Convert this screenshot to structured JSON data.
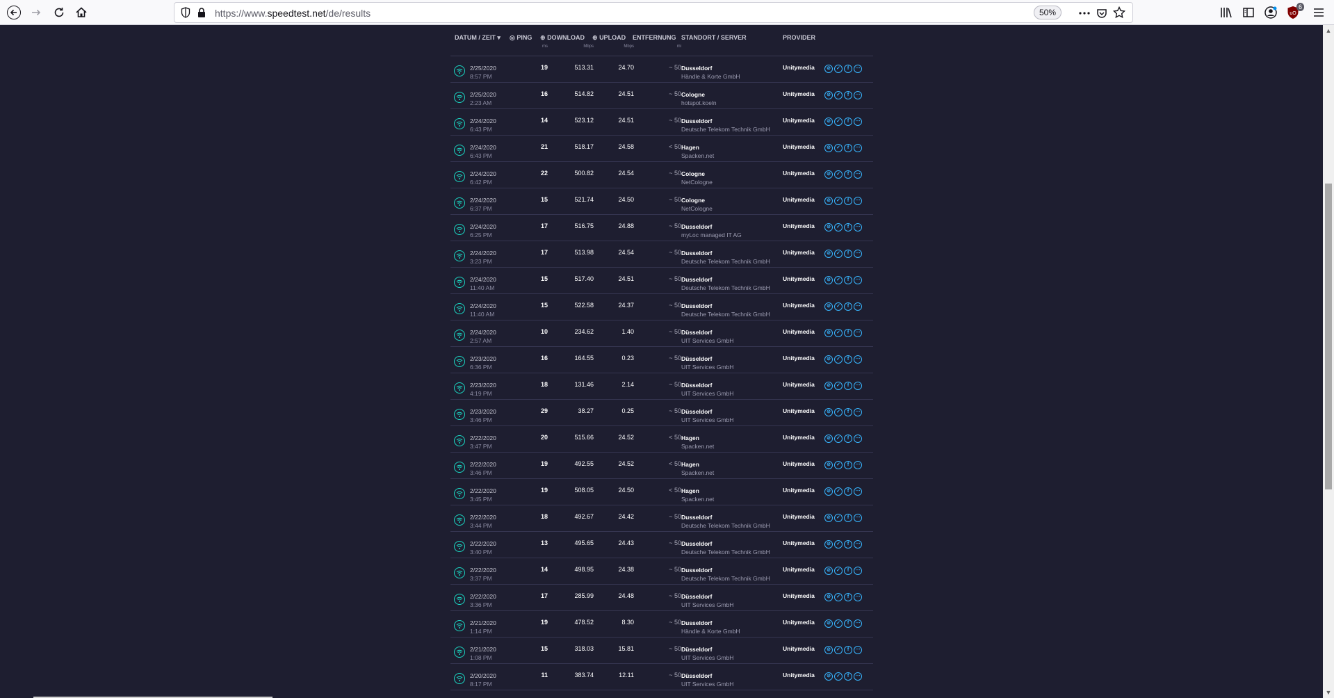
{
  "browser": {
    "url_prefix": "https://www.",
    "url_host": "speedtest.net",
    "url_path": "/de/results",
    "zoom": "50%",
    "addon_badge": "6"
  },
  "header": {
    "date": "DATUM / ZEIT",
    "ping": "PING",
    "ping_unit": "ms",
    "download": "DOWNLOAD",
    "download_unit": "Mbps",
    "upload": "UPLOAD",
    "upload_unit": "Mbps",
    "distance": "ENTFERNUNG",
    "distance_unit": "mi",
    "server": "STANDORT / SERVER",
    "provider": "PROVIDER"
  },
  "results": [
    {
      "date": "2/25/2020",
      "time": "8:57 PM",
      "ping": "19",
      "dl": "513.31",
      "ul": "24.70",
      "dist": "~ 50",
      "city": "Dusseldorf",
      "sponsor": "Händle & Korte GmbH",
      "provider": "Unitymedia"
    },
    {
      "date": "2/25/2020",
      "time": "2:23 AM",
      "ping": "16",
      "dl": "514.82",
      "ul": "24.51",
      "dist": "~ 50",
      "city": "Cologne",
      "sponsor": "hotspot.koeln",
      "provider": "Unitymedia"
    },
    {
      "date": "2/24/2020",
      "time": "6:43 PM",
      "ping": "14",
      "dl": "523.12",
      "ul": "24.51",
      "dist": "~ 50",
      "city": "Dusseldorf",
      "sponsor": "Deutsche Telekom Technik GmbH",
      "provider": "Unitymedia"
    },
    {
      "date": "2/24/2020",
      "time": "6:43 PM",
      "ping": "21",
      "dl": "518.17",
      "ul": "24.58",
      "dist": "< 50",
      "city": "Hagen",
      "sponsor": "Spacken.net",
      "provider": "Unitymedia"
    },
    {
      "date": "2/24/2020",
      "time": "6:42 PM",
      "ping": "22",
      "dl": "500.82",
      "ul": "24.54",
      "dist": "~ 50",
      "city": "Cologne",
      "sponsor": "NetCologne",
      "provider": "Unitymedia"
    },
    {
      "date": "2/24/2020",
      "time": "6:37 PM",
      "ping": "15",
      "dl": "521.74",
      "ul": "24.50",
      "dist": "~ 50",
      "city": "Cologne",
      "sponsor": "NetCologne",
      "provider": "Unitymedia"
    },
    {
      "date": "2/24/2020",
      "time": "6:25 PM",
      "ping": "17",
      "dl": "516.75",
      "ul": "24.88",
      "dist": "~ 50",
      "city": "Dusseldorf",
      "sponsor": "myLoc managed IT AG",
      "provider": "Unitymedia"
    },
    {
      "date": "2/24/2020",
      "time": "3:23 PM",
      "ping": "17",
      "dl": "513.98",
      "ul": "24.54",
      "dist": "~ 50",
      "city": "Dusseldorf",
      "sponsor": "Deutsche Telekom Technik GmbH",
      "provider": "Unitymedia"
    },
    {
      "date": "2/24/2020",
      "time": "11:40 AM",
      "ping": "15",
      "dl": "517.40",
      "ul": "24.51",
      "dist": "~ 50",
      "city": "Dusseldorf",
      "sponsor": "Deutsche Telekom Technik GmbH",
      "provider": "Unitymedia"
    },
    {
      "date": "2/24/2020",
      "time": "11:40 AM",
      "ping": "15",
      "dl": "522.58",
      "ul": "24.37",
      "dist": "~ 50",
      "city": "Dusseldorf",
      "sponsor": "Deutsche Telekom Technik GmbH",
      "provider": "Unitymedia"
    },
    {
      "date": "2/24/2020",
      "time": "2:57 AM",
      "ping": "10",
      "dl": "234.62",
      "ul": "1.40",
      "dist": "~ 50",
      "city": "Düsseldorf",
      "sponsor": "UIT Services GmbH",
      "provider": "Unitymedia"
    },
    {
      "date": "2/23/2020",
      "time": "6:36 PM",
      "ping": "16",
      "dl": "164.55",
      "ul": "0.23",
      "dist": "~ 50",
      "city": "Düsseldorf",
      "sponsor": "UIT Services GmbH",
      "provider": "Unitymedia"
    },
    {
      "date": "2/23/2020",
      "time": "4:19 PM",
      "ping": "18",
      "dl": "131.46",
      "ul": "2.14",
      "dist": "~ 50",
      "city": "Düsseldorf",
      "sponsor": "UIT Services GmbH",
      "provider": "Unitymedia"
    },
    {
      "date": "2/23/2020",
      "time": "3:46 PM",
      "ping": "29",
      "dl": "38.27",
      "ul": "0.25",
      "dist": "~ 50",
      "city": "Düsseldorf",
      "sponsor": "UIT Services GmbH",
      "provider": "Unitymedia"
    },
    {
      "date": "2/22/2020",
      "time": "3:47 PM",
      "ping": "20",
      "dl": "515.66",
      "ul": "24.52",
      "dist": "< 50",
      "city": "Hagen",
      "sponsor": "Spacken.net",
      "provider": "Unitymedia"
    },
    {
      "date": "2/22/2020",
      "time": "3:46 PM",
      "ping": "19",
      "dl": "492.55",
      "ul": "24.52",
      "dist": "< 50",
      "city": "Hagen",
      "sponsor": "Spacken.net",
      "provider": "Unitymedia"
    },
    {
      "date": "2/22/2020",
      "time": "3:45 PM",
      "ping": "19",
      "dl": "508.05",
      "ul": "24.50",
      "dist": "< 50",
      "city": "Hagen",
      "sponsor": "Spacken.net",
      "provider": "Unitymedia"
    },
    {
      "date": "2/22/2020",
      "time": "3:44 PM",
      "ping": "18",
      "dl": "492.67",
      "ul": "24.42",
      "dist": "~ 50",
      "city": "Dusseldorf",
      "sponsor": "Deutsche Telekom Technik GmbH",
      "provider": "Unitymedia"
    },
    {
      "date": "2/22/2020",
      "time": "3:40 PM",
      "ping": "13",
      "dl": "495.65",
      "ul": "24.43",
      "dist": "~ 50",
      "city": "Dusseldorf",
      "sponsor": "Deutsche Telekom Technik GmbH",
      "provider": "Unitymedia"
    },
    {
      "date": "2/22/2020",
      "time": "3:37 PM",
      "ping": "14",
      "dl": "498.95",
      "ul": "24.38",
      "dist": "~ 50",
      "city": "Dusseldorf",
      "sponsor": "Deutsche Telekom Technik GmbH",
      "provider": "Unitymedia"
    },
    {
      "date": "2/22/2020",
      "time": "3:36 PM",
      "ping": "17",
      "dl": "285.99",
      "ul": "24.48",
      "dist": "~ 50",
      "city": "Düsseldorf",
      "sponsor": "UIT Services GmbH",
      "provider": "Unitymedia"
    },
    {
      "date": "2/21/2020",
      "time": "1:14 PM",
      "ping": "19",
      "dl": "478.52",
      "ul": "8.30",
      "dist": "~ 50",
      "city": "Dusseldorf",
      "sponsor": "Händle & Korte GmbH",
      "provider": "Unitymedia"
    },
    {
      "date": "2/21/2020",
      "time": "1:08 PM",
      "ping": "15",
      "dl": "318.03",
      "ul": "15.81",
      "dist": "~ 50",
      "city": "Düsseldorf",
      "sponsor": "UIT Services GmbH",
      "provider": "Unitymedia"
    },
    {
      "date": "2/20/2020",
      "time": "8:17 PM",
      "ping": "11",
      "dl": "383.74",
      "ul": "12.11",
      "dist": "~ 50",
      "city": "Düsseldorf",
      "sponsor": "UIT Services GmbH",
      "provider": "Unitymedia"
    }
  ]
}
